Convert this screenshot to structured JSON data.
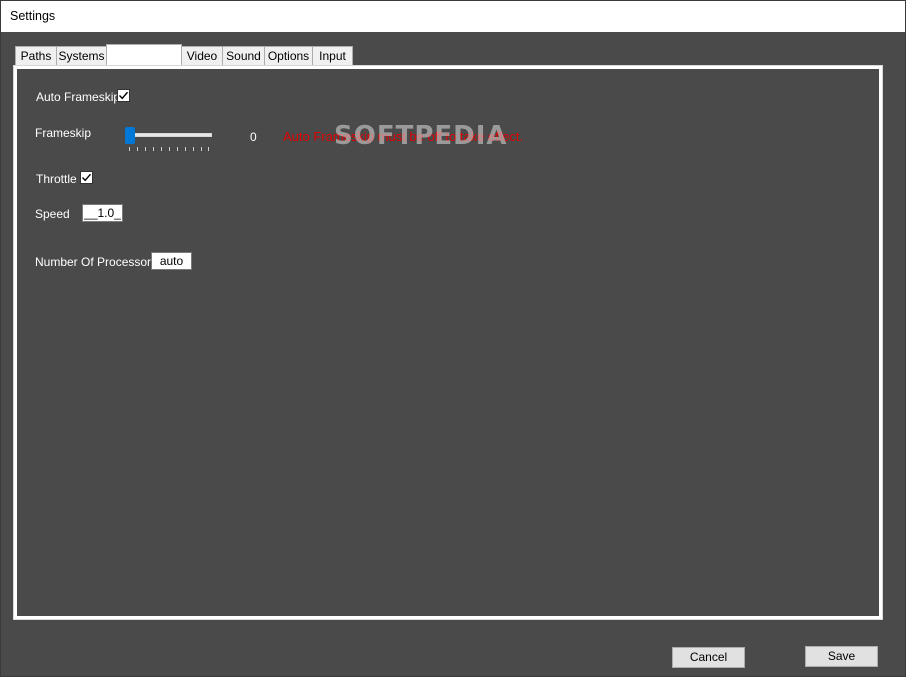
{
  "window": {
    "title": "Settings"
  },
  "tabs": [
    {
      "label": "Paths"
    },
    {
      "label": "Systems"
    },
    {
      "label": ""
    },
    {
      "label": "Video"
    },
    {
      "label": "Sound"
    },
    {
      "label": "Options"
    },
    {
      "label": "Input"
    }
  ],
  "settings": {
    "auto_frameskip": {
      "label": "Auto Frameskip",
      "checked": true
    },
    "frameskip": {
      "label": "Frameskip",
      "value": "0",
      "warning": "Auto Frameskip must be off to take effect."
    },
    "throttle": {
      "label": "Throttle",
      "checked": true
    },
    "speed": {
      "label": "Speed",
      "value": "__1.0_"
    },
    "processors": {
      "label": "Number Of Processors",
      "value": "auto"
    }
  },
  "watermark": "SOFTPEDIA",
  "buttons": {
    "cancel": "Cancel",
    "save": "Save"
  },
  "colors": {
    "panel_bg": "#4a4a4a",
    "warning": "#e00000",
    "slider_thumb": "#0078d7"
  }
}
